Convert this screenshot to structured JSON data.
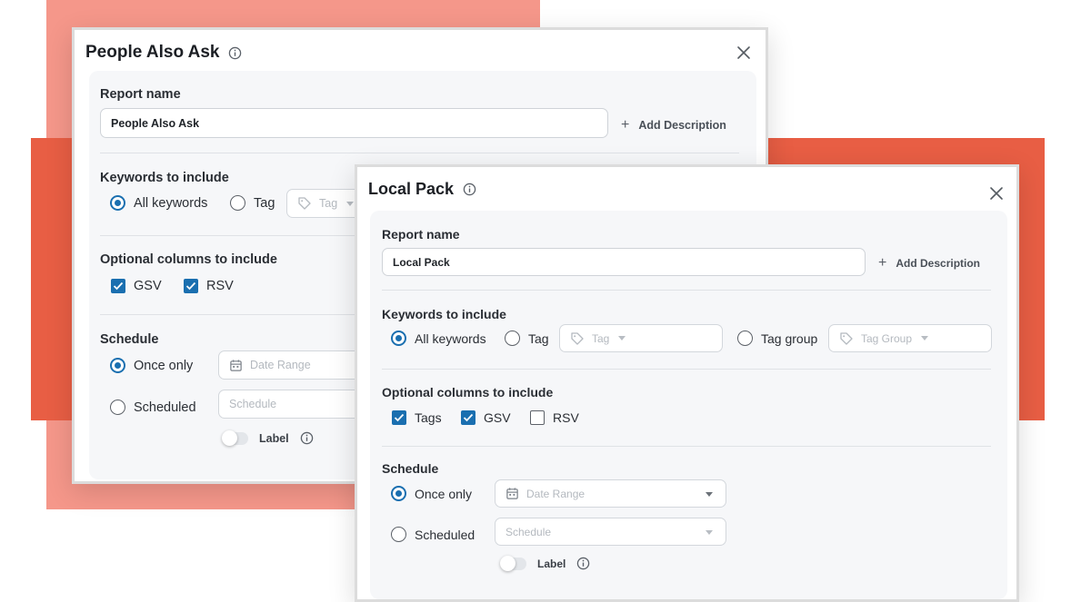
{
  "colors": {
    "accent": "#1a6fb0",
    "background_salmon": "#f5978a",
    "background_red": "#e85e44"
  },
  "paa_modal": {
    "title": "People Also Ask",
    "report_name_label": "Report name",
    "report_name_value": "People Also Ask",
    "add_description": "Add Description",
    "keywords_label": "Keywords to include",
    "all_keywords": "All keywords",
    "tag": "Tag",
    "tag_placeholder": "Tag",
    "optional_columns_label": "Optional columns to include",
    "gsv": "GSV",
    "rsv": "RSV",
    "schedule_label": "Schedule",
    "once_only": "Once only",
    "date_range_placeholder": "Date Range",
    "scheduled": "Scheduled",
    "schedule_placeholder": "Schedule",
    "toggle_label": "Label"
  },
  "lp_modal": {
    "title": "Local Pack",
    "report_name_label": "Report name",
    "report_name_value": "Local Pack",
    "add_description": "Add Description",
    "keywords_label": "Keywords to include",
    "all_keywords": "All keywords",
    "tag": "Tag",
    "tag_placeholder": "Tag",
    "tag_group": "Tag group",
    "tag_group_placeholder": "Tag Group",
    "optional_columns_label": "Optional columns to include",
    "tags": "Tags",
    "gsv": "GSV",
    "rsv": "RSV",
    "schedule_label": "Schedule",
    "once_only": "Once only",
    "date_range_placeholder": "Date Range",
    "scheduled": "Scheduled",
    "schedule_placeholder": "Schedule",
    "toggle_label": "Label"
  }
}
